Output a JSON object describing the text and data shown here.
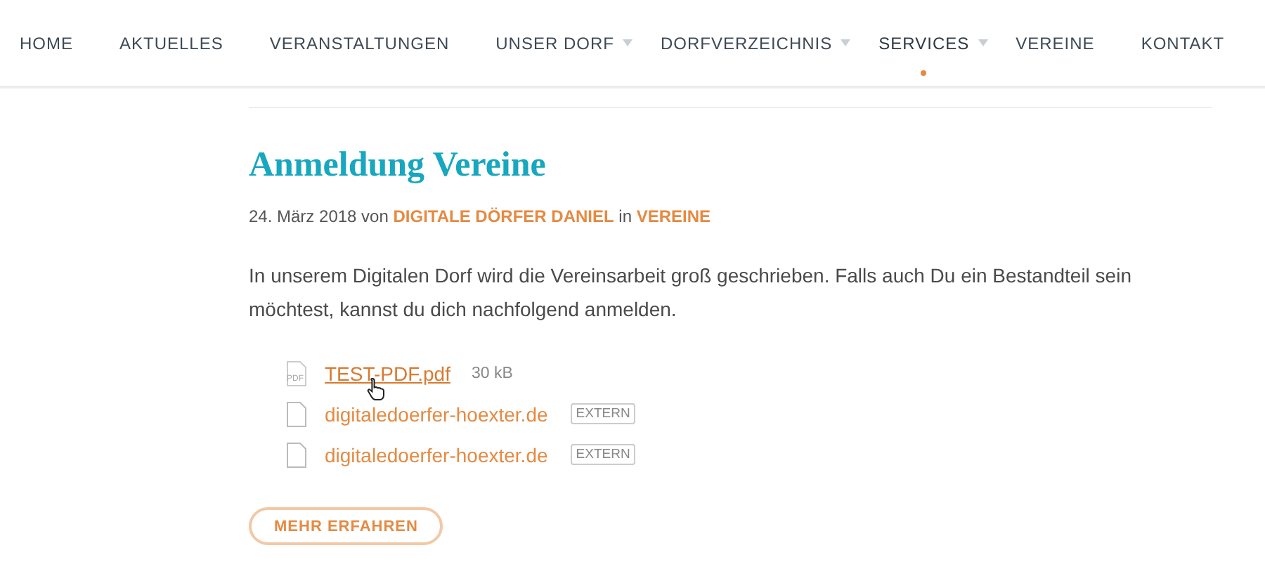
{
  "nav": [
    {
      "label": "HOME",
      "dropdown": false,
      "selected": false
    },
    {
      "label": "AKTUELLES",
      "dropdown": false,
      "selected": false
    },
    {
      "label": "VERANSTALTUNGEN",
      "dropdown": false,
      "selected": false
    },
    {
      "label": "UNSER DORF",
      "dropdown": true,
      "selected": false
    },
    {
      "label": "DORFVERZEICHNIS",
      "dropdown": true,
      "selected": false
    },
    {
      "label": "SERVICES",
      "dropdown": true,
      "selected": true
    },
    {
      "label": "VEREINE",
      "dropdown": false,
      "selected": false
    },
    {
      "label": "KONTAKT",
      "dropdown": false,
      "selected": false
    }
  ],
  "post": {
    "title": "Anmeldung Vereine",
    "meta": {
      "date": "24. März 2018",
      "by": "von",
      "author": "DIGITALE DÖRFER DANIEL",
      "in": "in",
      "category": "VEREINE"
    },
    "body": "In unserem Digitalen Dorf wird die Vereinsarbeit groß geschrieben. Falls auch Du ein Bestandteil sein möchtest, kannst du dich nachfolgend anmelden.",
    "attachments": [
      {
        "kind": "pdf",
        "icon_label": "PDF",
        "label": "TEST-PDF.pdf",
        "info": "30 kB",
        "hovered": true
      },
      {
        "kind": "extern",
        "label": "digitaledoerfer-hoexter.de",
        "info": "EXTERN",
        "hovered": false
      },
      {
        "kind": "extern",
        "label": "digitaledoerfer-hoexter.de",
        "info": "EXTERN",
        "hovered": false
      }
    ],
    "button": "MEHR ERFAHREN"
  }
}
